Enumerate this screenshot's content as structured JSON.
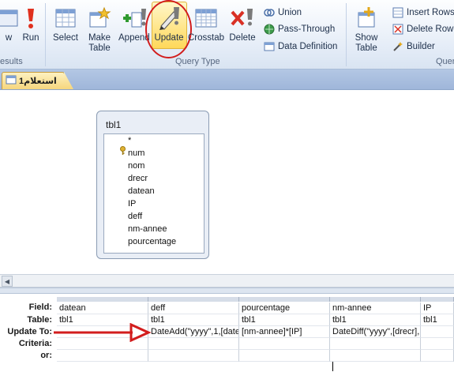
{
  "ribbon": {
    "results_group_label": "esults",
    "query_type_group_label": "Query Type",
    "query_setup_group_label": "Quer",
    "buttons": {
      "view": "w",
      "run": "Run",
      "select": "Select",
      "make_table": "Make Table",
      "append": "Append",
      "update": "Update",
      "crosstab": "Crosstab",
      "delete": "Delete",
      "union": "Union",
      "pass_through": "Pass-Through",
      "data_definition": "Data Definition",
      "show_table": "Show Table",
      "insert_rows": "Insert Rows",
      "delete_rows": "Delete Row",
      "builder": "Builder"
    }
  },
  "document_tab": {
    "label": "استعلام1"
  },
  "table": {
    "name": "tbl1",
    "fields": [
      "*",
      "num",
      "nom",
      "drecr",
      "datean",
      "IP",
      "deff",
      "nm-annee",
      "pourcentage"
    ],
    "key_field": "num"
  },
  "grid": {
    "row_labels": [
      "Field:",
      "Table:",
      "Update To:",
      "Criteria:",
      "or:"
    ],
    "columns": [
      {
        "field": "datean",
        "table": "tbl1",
        "update_to": "",
        "criteria": "",
        "or": ""
      },
      {
        "field": "deff",
        "table": "tbl1",
        "update_to": "DateAdd(\"yyyy\",1,[date",
        "criteria": "",
        "or": ""
      },
      {
        "field": "pourcentage",
        "table": "tbl1",
        "update_to": "[nm-annee]*[IP]",
        "criteria": "",
        "or": ""
      },
      {
        "field": "nm-annee",
        "table": "tbl1",
        "update_to": "DateDiff(\"yyyy\",[drecr],",
        "criteria": "",
        "or": ""
      },
      {
        "field": "IP",
        "table": "tbl1",
        "update_to": "",
        "criteria": "",
        "or": ""
      }
    ]
  },
  "colors": {
    "highlight_ring": "#d21d1d",
    "update_button_bg": "#ffd85a",
    "tab_active": "#f6d67d"
  }
}
